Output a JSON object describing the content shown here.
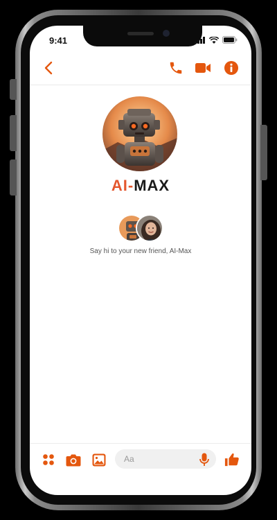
{
  "status": {
    "time": "9:41"
  },
  "profile": {
    "name_part1": "AI",
    "name_sep": "-",
    "name_part2": "MAX",
    "avatar_alt": "AI-Max robot avatar"
  },
  "conversation": {
    "intro_text": "Say hi to your new friend, AI-Max"
  },
  "composer": {
    "placeholder": "Aa"
  },
  "icons": {
    "back": "chevron-left-icon",
    "call": "phone-icon",
    "video": "video-icon",
    "info": "info-icon",
    "apps": "grid-dots-icon",
    "camera": "camera-icon",
    "gallery": "image-icon",
    "mic": "microphone-icon",
    "like": "thumbs-up-icon"
  },
  "colors": {
    "accent": "#e4570e",
    "brand_red": "#e4572e",
    "text_dark": "#1a1a1a"
  }
}
